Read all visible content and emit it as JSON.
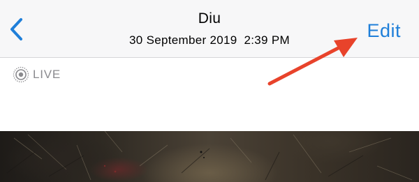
{
  "navbar": {
    "back_icon": "chevron-left-icon",
    "title": "Diu",
    "subtitle": "30 September 2019  2:39 PM",
    "edit_label": "Edit"
  },
  "live": {
    "icon": "live-photo-icon",
    "label": "LIVE"
  },
  "annotation": {
    "arrow_color": "#e8432b"
  },
  "colors": {
    "accent": "#1f7fd9",
    "navbar_bg": "#f7f7f8",
    "muted_text": "#8a8a8e"
  }
}
